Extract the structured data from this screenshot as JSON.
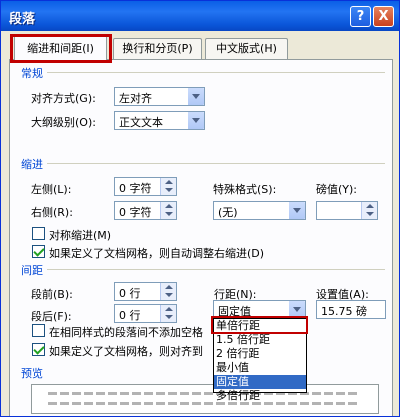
{
  "window": {
    "title": "段落",
    "help_label": "?",
    "close_label": "X"
  },
  "tabs": [
    {
      "label": "缩进和间距(I)",
      "active": true
    },
    {
      "label": "换行和分页(P)",
      "active": false
    },
    {
      "label": "中文版式(H)",
      "active": false
    }
  ],
  "general": {
    "section_label": "常规",
    "alignment_label": "对齐方式(G):",
    "alignment_value": "左对齐",
    "outline_label": "大纲级别(O):",
    "outline_value": "正文文本"
  },
  "indent": {
    "section_label": "缩进",
    "left_label": "左侧(L):",
    "left_value": "0 字符",
    "right_label": "右侧(R):",
    "right_value": "0 字符",
    "special_label": "特殊格式(S):",
    "special_value": "(无)",
    "by_label": "磅值(Y):",
    "mirror_label": "对称缩进(M)",
    "mirror_checked": false,
    "auto_adjust_label": "如果定义了文档网格，则自动调整右缩进(D)",
    "auto_adjust_checked": true
  },
  "spacing": {
    "section_label": "间距",
    "before_label": "段前(B):",
    "before_value": "0 行",
    "after_label": "段后(F):",
    "after_value": "0 行",
    "line_label": "行距(N):",
    "line_value": "固定值",
    "at_label": "设置值(A):",
    "at_value": "15.75 磅",
    "no_space_label": "在相同样式的段落间不添加空格",
    "no_space_checked": false,
    "snap_label": "如果定义了文档网格，则对齐到",
    "snap_checked": true
  },
  "line_spacing_options": [
    "单倍行距",
    "1.5 倍行距",
    "2 倍行距",
    "最小值",
    "固定值",
    "多倍行距"
  ],
  "line_spacing_selected": "固定值",
  "preview": {
    "section_label": "预览"
  }
}
